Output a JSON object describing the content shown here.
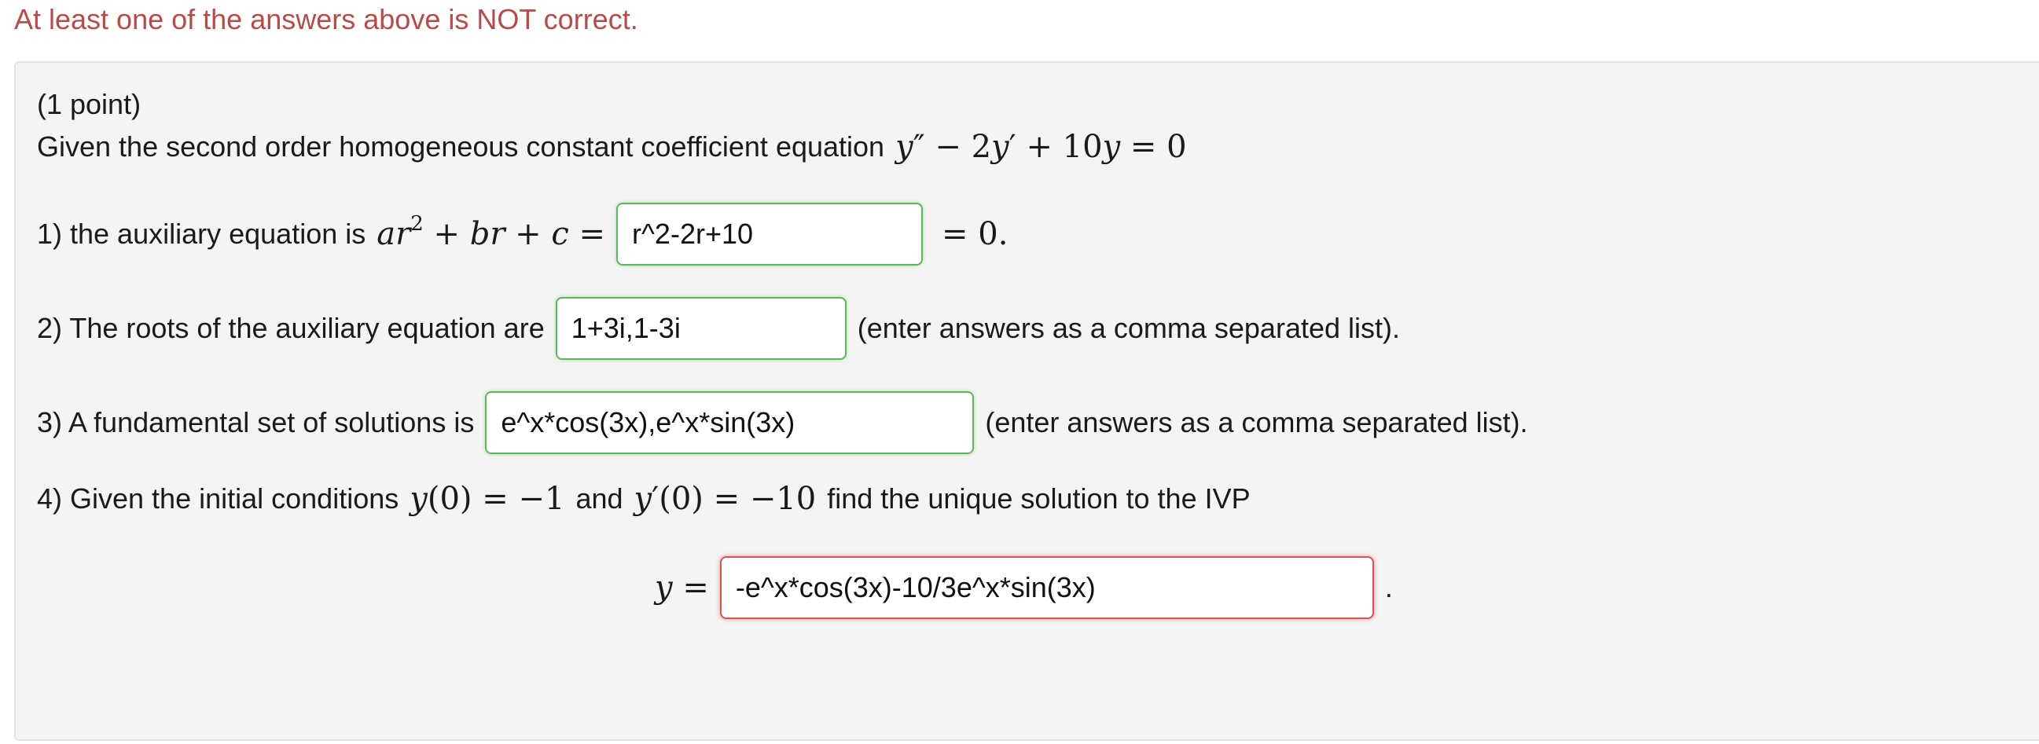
{
  "feedback": {
    "message": "At least one of the answers above is NOT correct."
  },
  "problem": {
    "points": "(1 point)",
    "intro": "Given the second order homogeneous constant coefficient equation",
    "parts": {
      "p1": {
        "prefix": "1) the auxiliary equation is",
        "answer": "r^2-2r+10",
        "suffix": "= 0.",
        "status": "correct"
      },
      "p2": {
        "prefix": "2) The roots of the auxiliary equation are",
        "answer": "1+3i,1-3i",
        "suffix": "(enter answers as a comma separated list).",
        "status": "correct"
      },
      "p3": {
        "prefix": "3) A fundamental set of solutions is",
        "answer": "e^x*cos(3x),e^x*sin(3x)",
        "suffix": "(enter answers as a comma separated list).",
        "status": "correct"
      },
      "p4": {
        "prefix": "4) Given the initial conditions",
        "and_text": "and",
        "tail": "find the unique solution to the IVP",
        "y_label": "y =",
        "answer": "-e^x*cos(3x)-10/3e^x*sin(3x)",
        "suffix": ".",
        "status": "incorrect"
      }
    }
  },
  "colors": {
    "feedback_text": "#b94a48",
    "correct_border": "#5cb85c",
    "incorrect_border": "#d9534f",
    "panel_bg": "#f4f4f4"
  }
}
